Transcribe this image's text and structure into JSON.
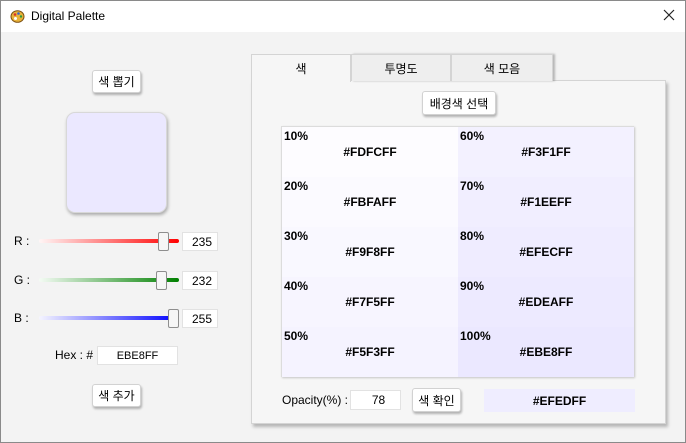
{
  "window": {
    "title": "Digital Palette"
  },
  "left": {
    "pick_button": "색 뽑기",
    "preview_color": "#EBE8FF",
    "sliders": [
      {
        "label": "R :",
        "value": "235",
        "track_start": "#fff6f6",
        "track_end": "#ff0000",
        "level": 0.92
      },
      {
        "label": "G :",
        "value": "232",
        "track_start": "#f4fbf4",
        "track_end": "#008000",
        "level": 0.91
      },
      {
        "label": "B :",
        "value": "255",
        "track_start": "#f5f5ff",
        "track_end": "#0000ff",
        "level": 1.0
      }
    ],
    "hex_label": "Hex : #",
    "hex_value": "EBE8FF",
    "add_button": "색 추가"
  },
  "tabs": [
    {
      "label": "색"
    },
    {
      "label": "투명도"
    },
    {
      "label": "색 모음"
    }
  ],
  "panel": {
    "bg_button": "배경색 선택",
    "shades": [
      {
        "percent": "10%",
        "hex": "#FDFCFF",
        "color": "#FDFCFF"
      },
      {
        "percent": "60%",
        "hex": "#F3F1FF",
        "color": "#F3F1FF"
      },
      {
        "percent": "20%",
        "hex": "#FBFAFF",
        "color": "#FBFAFF"
      },
      {
        "percent": "70%",
        "hex": "#F1EEFF",
        "color": "#F1EEFF"
      },
      {
        "percent": "30%",
        "hex": "#F9F8FF",
        "color": "#F9F8FF"
      },
      {
        "percent": "80%",
        "hex": "#EFECFF",
        "color": "#EFECFF"
      },
      {
        "percent": "40%",
        "hex": "#F7F5FF",
        "color": "#F7F5FF"
      },
      {
        "percent": "90%",
        "hex": "#EDEAFF",
        "color": "#EDEAFF"
      },
      {
        "percent": "50%",
        "hex": "#F5F3FF",
        "color": "#F5F3FF"
      },
      {
        "percent": "100%",
        "hex": "#EBE8FF",
        "color": "#EBE8FF"
      }
    ],
    "opacity_label": "Opacity(%) :",
    "opacity_value": "78",
    "check_button": "색 확인",
    "result_hex": "#EFEDFF",
    "result_color": "#EFEDFF"
  }
}
